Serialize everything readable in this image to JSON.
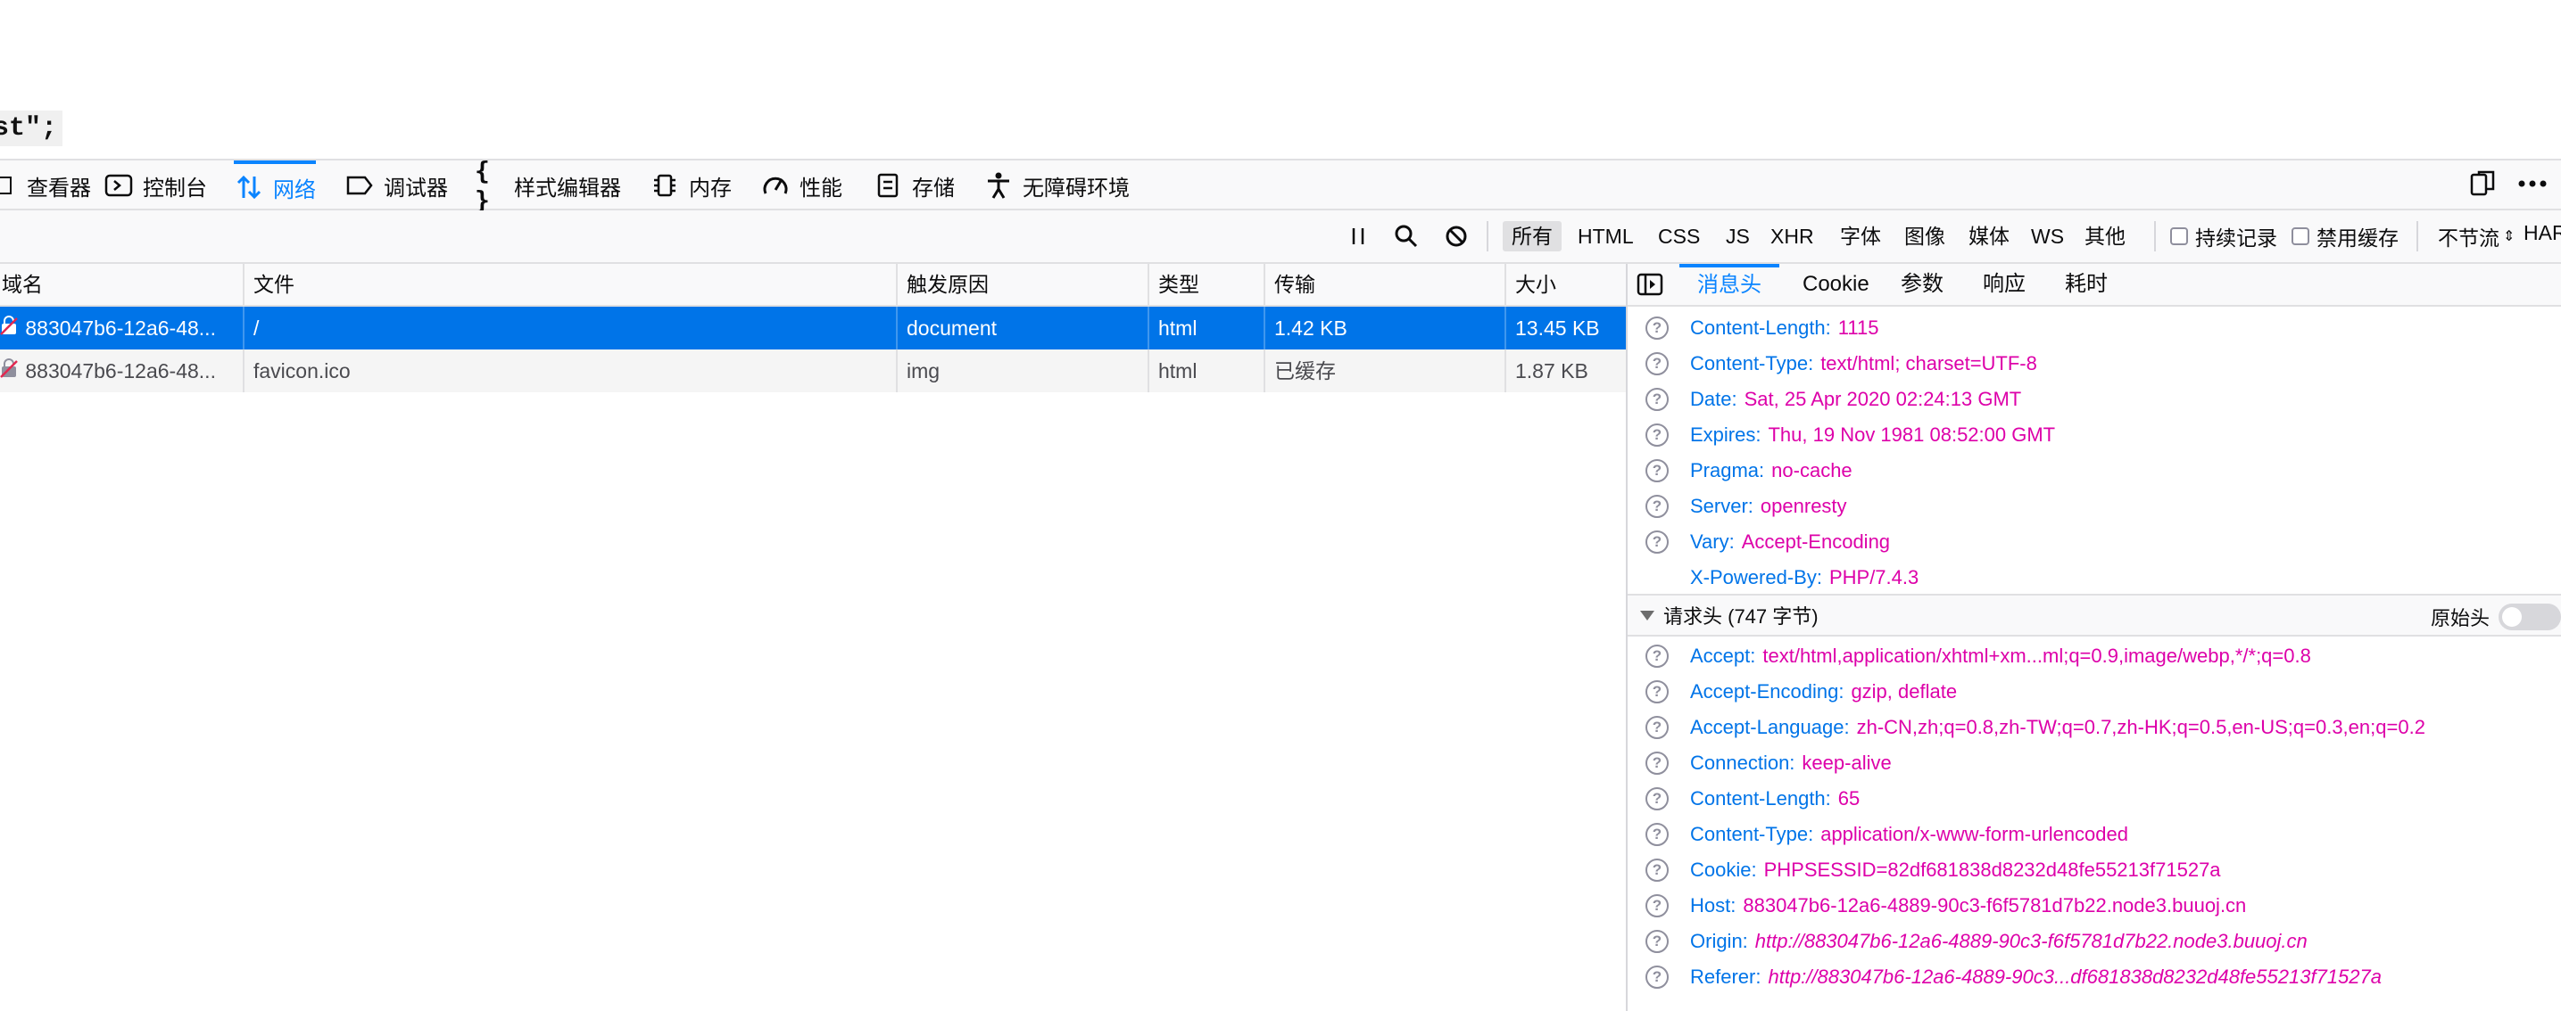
{
  "page": {
    "code_fragment": "st\";"
  },
  "toolbox": {
    "tabs": [
      {
        "label": "查看器",
        "icon": "inspector-icon"
      },
      {
        "label": "控制台",
        "icon": "console-icon"
      },
      {
        "label": "网络",
        "icon": "network-icon",
        "active": true
      },
      {
        "label": "调试器",
        "icon": "debugger-icon"
      },
      {
        "label": "样式编辑器",
        "icon": "style-editor-icon"
      },
      {
        "label": "内存",
        "icon": "memory-icon"
      },
      {
        "label": "性能",
        "icon": "performance-icon"
      },
      {
        "label": "存储",
        "icon": "storage-icon"
      },
      {
        "label": "无障碍环境",
        "icon": "accessibility-icon"
      }
    ]
  },
  "net_toolbar": {
    "filters": [
      "所有",
      "HTML",
      "CSS",
      "JS",
      "XHR",
      "字体",
      "图像",
      "媒体",
      "WS",
      "其他"
    ],
    "active_filter": "所有",
    "persist_logs": "持续记录",
    "disable_cache": "禁用缓存",
    "throttle": "不节流",
    "har": "HAR"
  },
  "requests": {
    "columns": [
      "域名",
      "文件",
      "触发原因",
      "类型",
      "传输",
      "大小"
    ],
    "rows": [
      {
        "domain": "883047b6-12a6-48...",
        "file": "/",
        "cause": "document",
        "type": "html",
        "transferred": "1.42 KB",
        "size": "13.45 KB"
      },
      {
        "domain": "883047b6-12a6-48...",
        "file": "favicon.ico",
        "cause": "img",
        "type": "html",
        "transferred": "已缓存",
        "size": "1.87 KB"
      }
    ]
  },
  "details": {
    "tabs": [
      "消息头",
      "Cookie",
      "参数",
      "响应",
      "耗时"
    ],
    "active_tab": "消息头",
    "response_headers": [
      {
        "k": "Content-Length:",
        "v": "1115"
      },
      {
        "k": "Content-Type:",
        "v": "text/html; charset=UTF-8"
      },
      {
        "k": "Date:",
        "v": "Sat, 25 Apr 2020 02:24:13 GMT"
      },
      {
        "k": "Expires:",
        "v": "Thu, 19 Nov 1981 08:52:00 GMT"
      },
      {
        "k": "Pragma:",
        "v": "no-cache"
      },
      {
        "k": "Server:",
        "v": "openresty"
      },
      {
        "k": "Vary:",
        "v": "Accept-Encoding"
      },
      {
        "k": "X-Powered-By:",
        "v": "PHP/7.4.3"
      }
    ],
    "request_section_title": "请求头 (747 字节)",
    "raw_label": "原始头",
    "request_headers": [
      {
        "k": "Accept:",
        "v": "text/html,application/xhtml+xm...ml;q=0.9,image/webp,*/*;q=0.8"
      },
      {
        "k": "Accept-Encoding:",
        "v": "gzip, deflate"
      },
      {
        "k": "Accept-Language:",
        "v": "zh-CN,zh;q=0.8,zh-TW;q=0.7,zh-HK;q=0.5,en-US;q=0.3,en;q=0.2"
      },
      {
        "k": "Connection:",
        "v": "keep-alive"
      },
      {
        "k": "Content-Length:",
        "v": "65"
      },
      {
        "k": "Content-Type:",
        "v": "application/x-www-form-urlencoded"
      },
      {
        "k": "Cookie:",
        "v": "PHPSESSID=82df681838d8232d48fe55213f71527a"
      },
      {
        "k": "Host:",
        "v": "883047b6-12a6-4889-90c3-f6f5781d7b22.node3.buuoj.cn"
      },
      {
        "k": "Origin:",
        "v": "http://883047b6-12a6-4889-90c3-f6f5781d7b22.node3.buuoj.cn"
      },
      {
        "k": "Referer:",
        "v": "http://883047b6-12a6-4889-90c3...df681838d8232d48fe55213f71527a"
      }
    ]
  }
}
